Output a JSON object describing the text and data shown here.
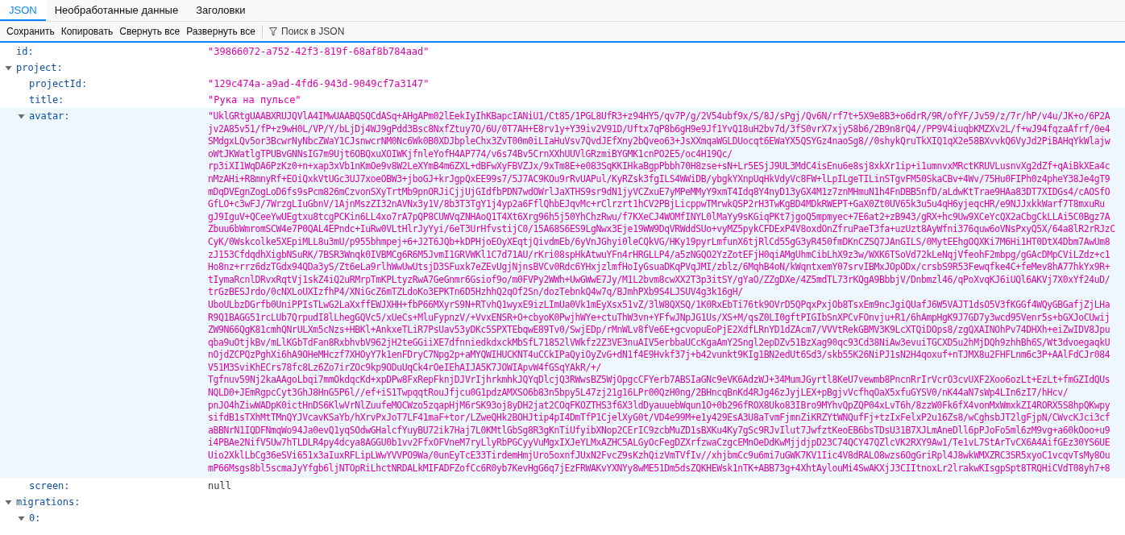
{
  "tabs": [
    {
      "label": "JSON",
      "selected": true
    },
    {
      "label": "Необработанные данные",
      "selected": false
    },
    {
      "label": "Заголовки",
      "selected": false
    }
  ],
  "toolbar": {
    "buttons": [
      "Сохранить",
      "Копировать",
      "Свернуть все",
      "Развернуть все"
    ],
    "filter": {
      "placeholder": "Поиск в JSON"
    }
  },
  "tree": [
    {
      "key": "id:",
      "kind": "string",
      "selected": false,
      "value": "\"39866072-a752-42f3-819f-68af8b784aad\""
    },
    {
      "key": "project:",
      "kind": "object",
      "selected": false,
      "expanded": true,
      "children": [
        {
          "key": "projectId:",
          "kind": "string",
          "selected": false,
          "value": "\"129c474a-a9ad-4fd6-943d-9049cf7a3147\""
        },
        {
          "key": "title:",
          "kind": "string",
          "selected": false,
          "value": "\"Рука на пульсе\""
        },
        {
          "key": "avatar:",
          "kind": "long_string",
          "selected": true,
          "expanded": true,
          "value_lines": [
            "\"UklGRtgUAABXRUJQVlA4IMwUAABQSQCdASq+AHgAPm02lEekIyIhKBapcIANiU1/Ct85/1PGL8UfR3+z94HY5/qv7P/g/2V54ubf9x/S/8J/sPgj/Qv6N/rf7t+5X9e8B3+o6drR/9R/ofYF/Jv59/z/7r/hP/v4u/JK+o/6P2A",
            "jv2A85v51/fP+z9wH0L/VP/Y/bLjDj4WJ9gPdd3Bsc8NxfZtuy7O/6U/0T7AH+E8rv1y+Y39iv2V91D/Uftx7qP8b6gH9e9Jf1YvQ18uH2bv7d/3fS0vrX7xjy58b6/2B9n8rQ4//PP9V4iuqbKMZXv2L/f+wJ94fqzaAfrf/0e4",
            "SMdgxLQv5or3BcwrNyNbcZWaY1CJsnwcrNM0Nc6Wk0B0XDJbpleChx3ZvT00m0iLIaHuVsv7QvdJEfXny2bQveo63+JsXXmqaWGLDUocqt6EWaYX5QSYGz4naoSg8//0shykQruTkXIQ1qX2e58BXvvkQ6VyJd2PiBAHqYkWlajw",
            "oWtJKWatlgTPUBvGNNsIG7m9Ujt6OBQxuXOIWKjfnleYofH4AP774/v6s74Bv5CrnXXhUUVlGRzmiBYGMK1cnPO2E5/oc4H19Qc/",
            "rp3iXI1WqDA6PzKz0+n+xap3xVb1nKmOe9v8W2LeXYmB4m6ZXL+dBFwXyFBVZJx/9xTm8E+e083SqKKIHkaBgpPbbh70H8zse+sN+Lr5ESjJ9UL3MdC4isEnu6e8sj8xkXr1ip+i1umnvxMRctKRUVLusnvXg2dZf+qAiBkXEa4c",
            "nMzAHi+R8mnyRf+EOiQxkVtUGc3UJ7xoeOBW3+jboGJ+krJgpQxEE99s7/5J7AC9KOu9rRvUAPul/KyRZsk3fgILS4WWiDB/ybgkYXnpUqHkVdyVc8FW+lLpILgeTILinSTgvFM50SkaCBv+4Wv/75Hu0FIPh0z4pheY38Je4gT9",
            "mDqDVEgnZogLoD6fs9sPcm826mCzvonSXyTrtMb9pnORJiCjjUjGIdfbPDN7wdOWrlJaXTHS9sr9dN1jyVCZxuE7yMPeMMyY9xmT4Idq8Y4nyD13yGX4M1z7znMHmuN1h4FnDBB5nfD/aLdwKtTrae9HAa83DT7XIDGs4/cAOSfO",
            "GfLO+c3wFJ/7WrzgLIuGbnV/1AjnMszZI32nAVNx3y1V/8b3T3TgY1j4yp2a6FflQhbEJqvMc+rClrzrt1hCV2PBjLicppwTMrwkQSP2rH3TwKgBD4MDkRWEPT+GaX0Zt0UV65k3u5u4qH6yjeqcHR/e9NJJxkkWarf7T8mxuRu",
            "gJ9IguV+QCeeYwUEgtxu8tcgPCKin6LL4xo7rA7pQP8CUWVqZNHAoQ1T4Xt6Xrg96h5j50YhChzRwu/f7KXeCJ4WOMfINYL0lMaYy9sKGiqPKt7jgoQ5mpmyec+7E6at2+zB943/gRX+hc9Uw9XCeYcQX2aCbgCkLLAi5C0Bgz7A",
            "Zbuu6bWmromSCW4e7P0QAL4EPndc+IuRw0VLtHlrJyYyi/6eT3UrHfvstijC0/15A68S6ES9LgNwx3Eje19WW9DqVRWddSUo+vyMZ5pykCFDExP4V8oxdOnZfruPaeT3fa+uzUzt8AyWfni376quw6oVNsPxyQ5X/64a8lR2rRJzC",
            "CyK/0Wskcolke5XEpiMLL8u3mU/p955bhmpej+6+J2T6JQb+kDPHjoEOyXEqtjQivdmEb/6yVnJGhyi0leCQkVG/HKy19pyrLmfunX6tjRlCd55gG3yR450fmDKnCZSQ7JAnGILS/0MytEEhgOQXKi7M6Hi1HT0DtX4Dbm7AwUm8",
            "zJ153CfdqdhXigbNSuRK/7BSR3Wnqk0IVBMCg6R6M5JvmI1GRVWKl1C7d71AU/rKri08spHkAtwuYFn4rHRGLLP4/a5zNGQO2YzZotEFjH0qiAMgUhmCibLhX9z3w/WXK6TSoVd72kLeNqjVfeohF2mbpg/gGAcDMpCViLZdz+c1",
            "Ho8nz+rrz6dzTGdx94QDa3yS/Zt6eLa9rlhWwUwUtsjD3SFuxk7eZEvUgjNjnsBVCv0Rdc6YHxjzlmfHoIyGsuaDKqPVqJMI/zblz/6MqhB4oN/kWqntxemY07srvIBMxJOpODx/crsbS9R53Fewqfke4C+feMev8hA77hkYx9R+",
            "tIymaRcnlDRvxRqtVj1skZ4iQ2uRMrpTmKPLtyzRwA7GeGnmr6Gsiof9o/m0FVPy2WWh+UwGWwE7Jy/M1L2bvm8cwXX2T3p3itSY/gYaO/ZZgDXe/4Z5mdTL73rKQgA9BbbjV/Dnbmzl46/qPoXvqKJ6iUQl6AKVj7X0xYf24uD/",
            "trGzBESJrdo/0cNXLoUXIzfhP4/XNiGcZ6mTZLdoKo3EPKTn6D5HzhhQ2qOf2Sn/dozTebnkQ4w7q/BJmhPXb9S4LJSUV4g3k16gH/",
            "UboULbzDGrfb0UniPPIsTLwG2LaXxffEWJXHH+fbP66MXyrS9N+RTvhQ1wyxE9izLImUa0Vk1mEyXsx51vZ/3lW8QXSQ/1K0RxEbTi76tk9OVrD5QPqxPxjOb8TsxEm9ncJgiQUafJ6W5VAJT1dsO5V3fKGGf4WQyGBGafjZjLHa",
            "R9Q1BAGG51rcLUb7QrpudI8lLhegGQVc5/xUeCs+MluFypnzV/+VvxENSR+O+cbyoK0PwjhWYe+ctuThW3vn+YFfwJNpJG1Us/XS+M/qsZ0LI0gftPIGIbSnXPCvFOnvju+R1/6hAmpHgK9J7GD7y3wcd95Venr5s+bGXJoCUwij",
            "ZW9N66QgK81cmhQNrULXm5cNzs+HBKl+AnkxeTLiR7PsUav53yDKc5SPXTEbqwE89Tv0/SwjEDp/rMnWLv8fVe6E+gcvopuEoPjE2XdfLRnYD1dZAcm7/VVVtRekGBMV3K9LcXTQiDOps8/zgQXAINOhPv74DHXh+eiZwIDV8Jpu",
            "qba9uOtjkBv/mLlKGbTdFan8RxbhvbV962jH2teGGiiXE7dfnniedkdxckMbSfL71852lVWkfz2Z3VE3nuAIV5erbbaUCcKgaAmY2Sngl2epDZv51BzXag90qc93Cd38NiAw3evuiTGCXD5u2hMjDQh9zhhBh6S/Wt3dvoegaqkU",
            "nOjdZCPQzPghXi6hA9OHeMHczf7XHOyY7k1enFDryC7Npg2p+aMYQWIHUCKNT4uCCkIPaQyiOyZvG+dN1f4E9Hvkf37j+b42vunkt9KIg1BN2edUt6Sd3/skb55K26NiPJ1sN2H4qoxuf+nTJMX8u2FHFLnm6c3P+AAlFdCJr084",
            "V51M3SviKhECrs78fc8Lz6Zo7irZOc9kp9ODuUqCk4rOeIEhAIJA5K7JOWIApvW4fGSqYAkR/+/",
            "Tgfnuv59Nj2kaAAgoLbqi7mmOkdqcKd+xpDPw8FxRepFknjDJVrIjhrkmhkJQYqDlcjQ3RWwsBZ5WjOpgcCFYerb7ABSIaGNc9eVK6AdzWJ+34MumJGyrtl8KeU7vewmb8PncnRrIrVcrO3cvUXF2Xoo6ozLt+EzLt+fmGZIdQUs",
            "NQLD0+JEmRgpcCyt3GhJ8HnG5P6l//ef+iS1TwpqqtRouJfjcu0G1pdzAMXSO6b83n5bpy5L47zj21g16LPr00QzH0ng/2BHncqBnKd4RJg46zJyjLEX+pBgjvVcfhqOaX5xfuGYSV0/nK44aN7sWp4LIn6zI7/hHcv/",
            "pnJO4hZiwWADpK0ictHnDS6KlwVrNlZuufeMOCWzo5zqapHjM6rSK93oj8yDH2jat2COqFKOZTHS3f6X3ldDyauuebWqun1O+0b296fROX8Uko83IBro9MYhvQpZQP04xLvT6h/8zzW0Fk6fX4vonMxWmxkZI4RORX5S8hpQKwpy",
            "sifdB1sTXhMtTMnQYJVcavKSaYb/hXrvPxJoT7LF41maF+tor/LZweQHk2BOHJtip4pI4DmTfP1CjelXyG0t/VD4e99M+e1y429EsA3U8aTvmFjmnZiKRZYtWNQufFj+tzIxFelxP2u16Zs8/wCghsbJT2lgFjpN/CWvcKJci3cf",
            "aBBNrN1IQDFNmqWo94Ja0evQ1yqSOdwGHalcfYuyBU72ik7Haj7L0KMtlGbSg8R3gKnTiUfyibXNop2CErIC9zcbMuZD1sBXKu4Ky7gSc9RJvIlut7JwfztKeoEB6bsTDsU31B7XJLmAneDll6pPJoFo5ml6zM9vg+a60kOoo+u9",
            "i4PBAe2NifV5Uw7hTLDLR4py4dcya8AGGU0b1vv2FfxOFVneM7ryLlyRbPGCyyVuMgxIXJeYLMxAZHC5ALGyOcFegDZXrfzwaCzgcEMnOeDdKwMjjdjpD23C74QCY47QZlcVK2RXY9Aw1/Te1vL7StArTvCX6A4AifGEz30YS6UE",
            "Uio2XklLbCg36eSVi651x3aIuxRFLipLWwYVVPO9Wa/0unEyTcE33TirdemHmjUro5oxnfJUxN2FvcZ9sKzhQizVmTVfIv//xhjbmCc9u6mi7uGWK7KV1Iic4V8dRALO8wzs6OgGriRpl4J8wkWMXZRC3SR5xyoC1vcqvTsMy8Ou",
            "mP66Msgs8bl5scmaJyYfgb6ljNTOpRiLhctNRDALkMIFADFZofCc6R0yb7KevHgG6q7jEzFRWAKvYXNYy8wME51Dm5dsZQKHEWsk1nTK+ABB73g+4XhtAylouMi4SwAKXjJ3CIItnoxLr2lrakwKIsgpSpt8TRQHiCVdT08yh7+8"
          ]
        },
        {
          "key": "screen:",
          "kind": "null",
          "selected": false,
          "value": "null"
        }
      ]
    },
    {
      "key": "migrations:",
      "kind": "array",
      "selected": false,
      "expanded": true,
      "children": [
        {
          "key": "0:",
          "kind": "object",
          "selected": false,
          "expanded": true
        }
      ]
    }
  ]
}
